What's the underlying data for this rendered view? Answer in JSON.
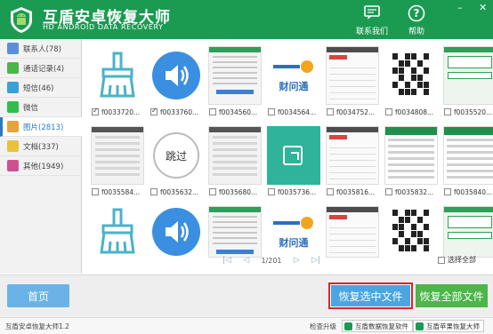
{
  "header": {
    "title": "互盾安卓恢复大师",
    "subtitle": "HD ANDROID DATA RECOVERY",
    "contact_label": "联系我们",
    "help_label": "帮助",
    "minimize": "–",
    "close": "✕"
  },
  "sidebar": {
    "items": [
      {
        "label": "联系人(78)",
        "icon": "contacts-icon",
        "color": "#5b8fd6"
      },
      {
        "label": "通话记录(4)",
        "icon": "call-log-icon",
        "color": "#4cb648"
      },
      {
        "label": "短信(46)",
        "icon": "sms-icon",
        "color": "#3aa0d8"
      },
      {
        "label": "微信",
        "icon": "wechat-icon",
        "color": "#2fbf4a"
      },
      {
        "label": "图片(2813)",
        "icon": "photos-icon",
        "color": "#e8a23a"
      },
      {
        "label": "文档(337)",
        "icon": "documents-icon",
        "color": "#e9c23c"
      },
      {
        "label": "其他(1949)",
        "icon": "other-icon",
        "color": "#d14f8e"
      }
    ]
  },
  "grid": {
    "rows": [
      [
        {
          "name": "f0033720...",
          "type": "broom",
          "checked": true
        },
        {
          "name": "f0033760...",
          "type": "audio",
          "checked": true
        },
        {
          "name": "f0034560...",
          "type": "phone",
          "checked": false
        },
        {
          "name": "f0034564...",
          "type": "logo",
          "checked": false
        },
        {
          "name": "f0034752...",
          "type": "list",
          "checked": false
        },
        {
          "name": "f0034808...",
          "type": "qr",
          "checked": false
        },
        {
          "name": "f0035520...",
          "type": "chat",
          "checked": false
        }
      ],
      [
        {
          "name": "f0035584...",
          "type": "addcontact",
          "checked": false
        },
        {
          "name": "f0035632...",
          "type": "skip",
          "checked": false
        },
        {
          "name": "f0035680...",
          "type": "addcontact",
          "checked": false
        },
        {
          "name": "f0035736...",
          "type": "teal",
          "checked": false
        },
        {
          "name": "f0035816...",
          "type": "list",
          "checked": false
        },
        {
          "name": "f0035832...",
          "type": "greenbar",
          "checked": false
        },
        {
          "name": "f0035840...",
          "type": "greenbar",
          "checked": false
        }
      ],
      [
        {
          "name": "",
          "type": "broom",
          "checked": false
        },
        {
          "name": "",
          "type": "audio",
          "checked": false
        },
        {
          "name": "",
          "type": "phone",
          "checked": false
        },
        {
          "name": "",
          "type": "logo",
          "checked": false
        },
        {
          "name": "",
          "type": "list",
          "checked": false
        },
        {
          "name": "",
          "type": "qr",
          "checked": false
        },
        {
          "name": "",
          "type": "chat",
          "checked": false
        }
      ]
    ],
    "logo_text": "财问通",
    "skip_text": "跳过"
  },
  "pager": {
    "page_text": "1/201",
    "first": "|◁",
    "prev": "◁",
    "next": "▷",
    "last": "▷|"
  },
  "select_all_label": "选择全部",
  "buttons": {
    "home": "首页",
    "recover_selected": "恢复选中文件",
    "recover_all": "恢复全部文件"
  },
  "status": {
    "version": "互盾安卓恢复大师1.2",
    "upgrade": "检查升级",
    "link1": "互盾数据恢复软件",
    "link2": "互盾苹果恢复大师"
  },
  "colors": {
    "header": "#1b9a52",
    "accent_blue": "#4ba5e0",
    "accent_green": "#4cb648",
    "highlight_red": "#d6262c"
  }
}
